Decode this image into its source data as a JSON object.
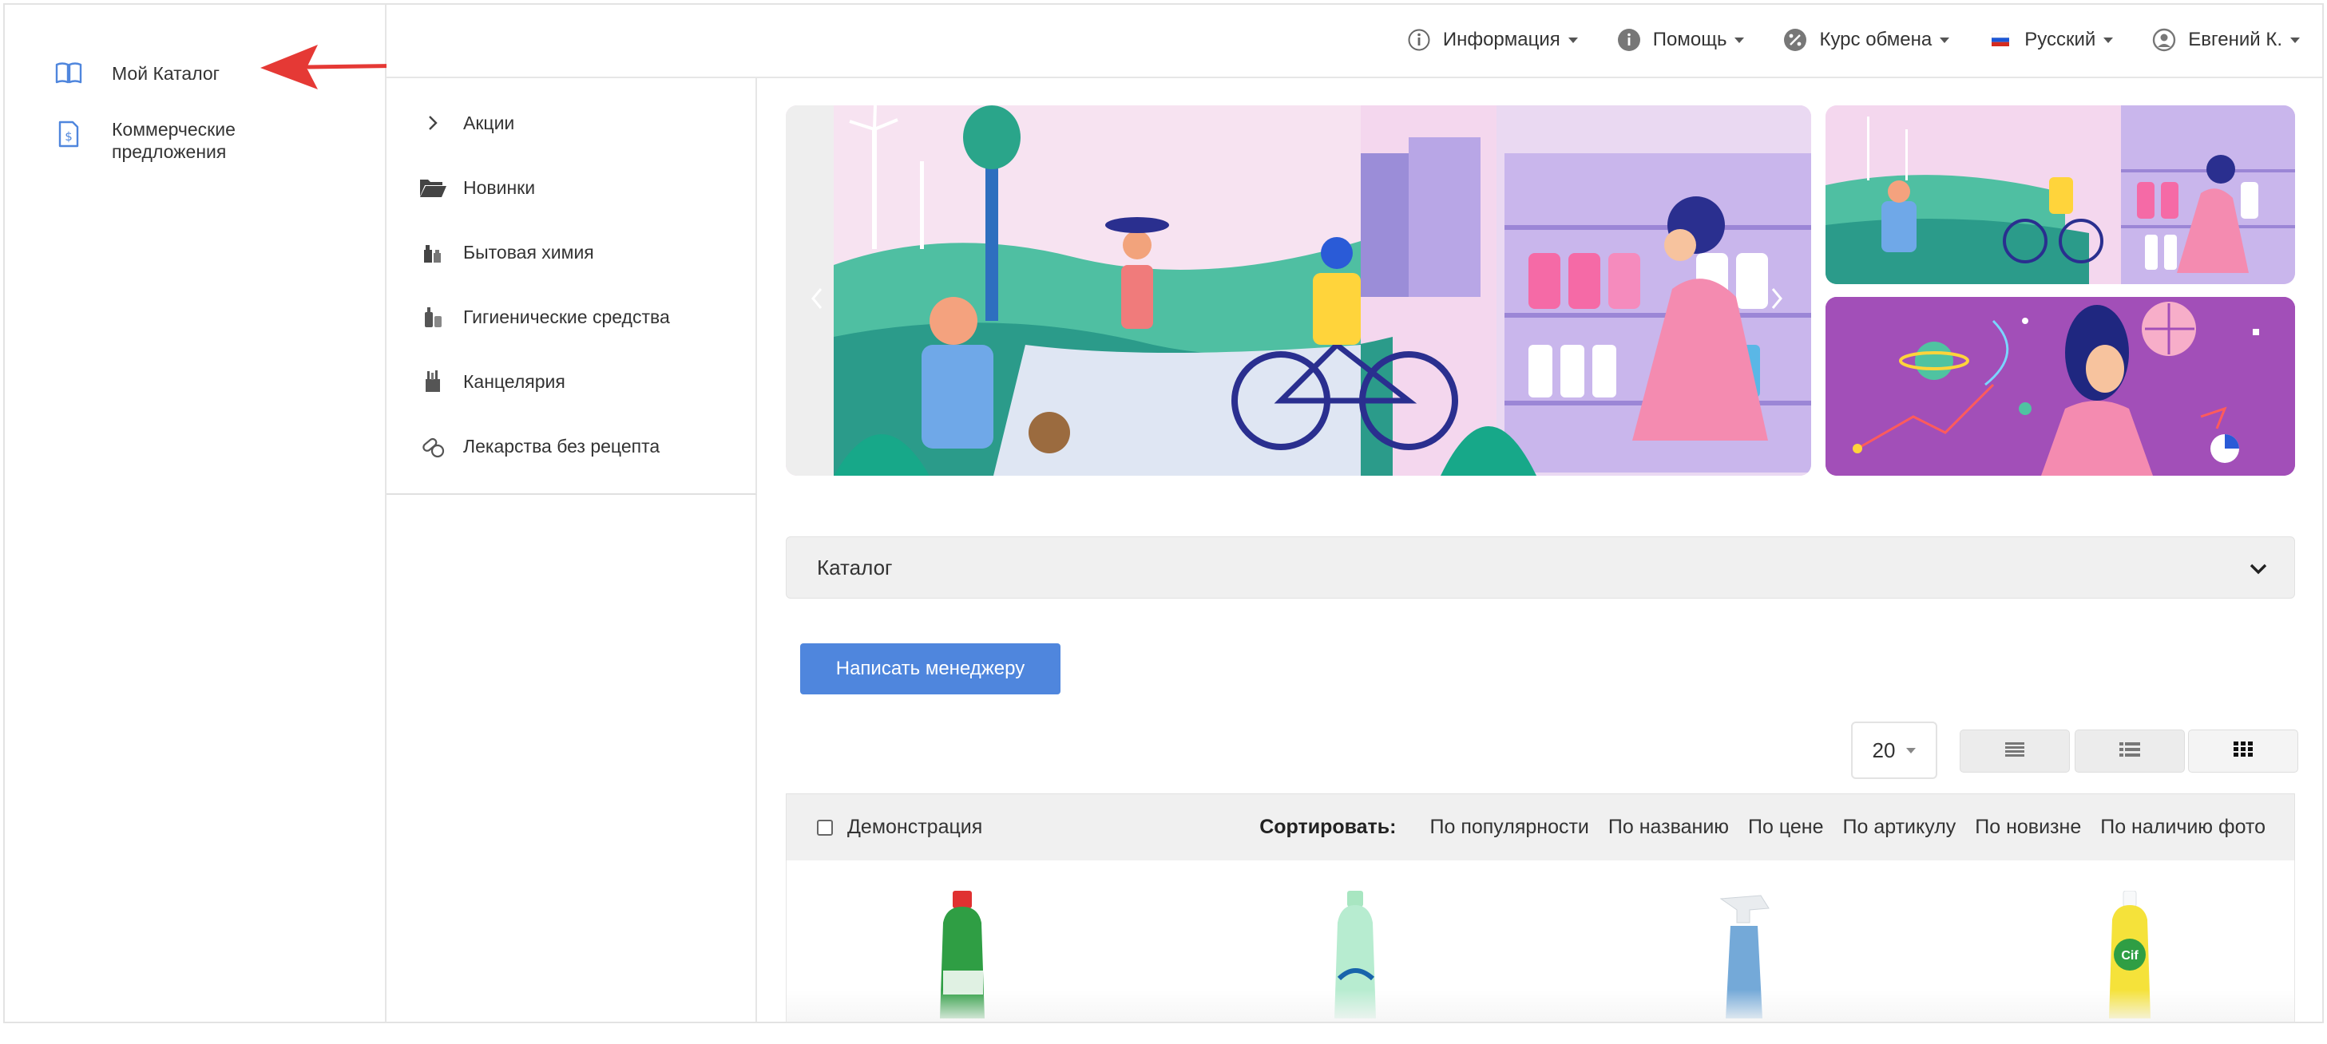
{
  "sidebar": {
    "items": [
      {
        "label": "Мой Каталог",
        "icon": "book-icon"
      },
      {
        "label": "Коммерческие предложения",
        "icon": "dollar-document-icon"
      }
    ]
  },
  "topnav": {
    "items": [
      {
        "label": "Информация",
        "icon": "info-circle-icon"
      },
      {
        "label": "Помощь",
        "icon": "help-icon"
      },
      {
        "label": "Курс обмена",
        "icon": "percent-icon"
      },
      {
        "label": "Русский",
        "icon": "russian-flag-icon"
      },
      {
        "label": "Евгений К.",
        "icon": "user-avatar-icon"
      }
    ]
  },
  "categories": [
    {
      "label": "Акции",
      "icon": "chevron-right-icon"
    },
    {
      "label": "Новинки",
      "icon": "folder-open-icon"
    },
    {
      "label": "Бытовая химия",
      "icon": "household-chemicals-icon"
    },
    {
      "label": "Гигиенические средства",
      "icon": "hygiene-icon"
    },
    {
      "label": "Канцелярия",
      "icon": "stationery-icon"
    },
    {
      "label": "Лекарства без рецепта",
      "icon": "pills-icon"
    }
  ],
  "catalog": {
    "label": "Каталог"
  },
  "manager_button": {
    "label": "Написать менеджеру"
  },
  "per_page": {
    "value": "20"
  },
  "demo": {
    "label": "Демонстрация"
  },
  "sort": {
    "label": "Сортировать:",
    "options": [
      "По популярности",
      "По названию",
      "По цене",
      "По артикулу",
      "По новизне",
      "По наличию фото"
    ]
  },
  "colors": {
    "accent": "#4f86dd",
    "arrow": "#e53935",
    "panel": "#f0f0f0"
  }
}
